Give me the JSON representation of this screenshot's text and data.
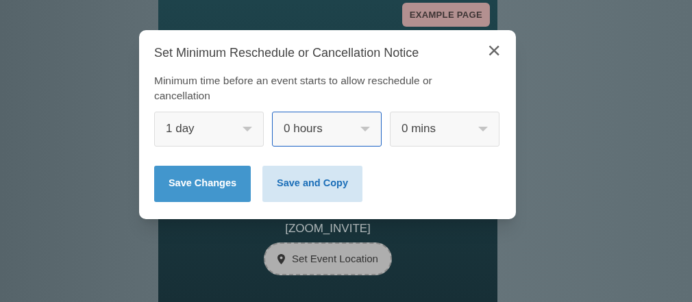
{
  "page": {
    "badge": "EXAMPLE PAGE",
    "placeholder_text": "[ZOOM_INVITE]",
    "location_button": "Set Event Location"
  },
  "dialog": {
    "title": "Set Minimum Reschedule or Cancellation Notice",
    "close": "×",
    "description": "Minimum time before an event starts to allow reschedule or cancellation",
    "selects": [
      {
        "value": "1 day",
        "focused": false
      },
      {
        "value": "0 hours",
        "focused": true
      },
      {
        "value": "0 mins",
        "focused": false
      }
    ],
    "buttons": [
      {
        "label": "Save Changes",
        "kind": "primary"
      },
      {
        "label": "Save and Copy",
        "kind": "secondary"
      }
    ]
  }
}
